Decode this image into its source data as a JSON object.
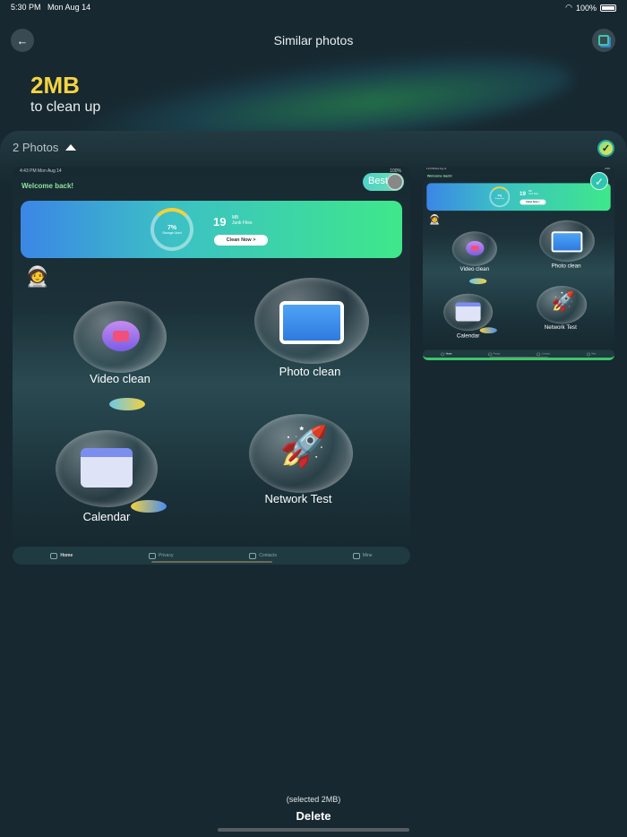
{
  "status_bar": {
    "time": "5:30 PM",
    "date": "Mon Aug 14",
    "battery": "100%"
  },
  "header": {
    "title": "Similar photos",
    "back_icon": "arrow-left-icon",
    "action_icon": "select-all-icon"
  },
  "summary": {
    "size": "2MB",
    "caption": "to clean up"
  },
  "group": {
    "label": "2 Photos",
    "all_selected": true
  },
  "photo": {
    "status": "4:43 PM   Mon Aug 14",
    "status_right": "100%",
    "welcome": "Welcome back!",
    "best_badge": "Best",
    "storage_pct": "7%",
    "storage_label": "Storage Used",
    "storage_progress": 0.07,
    "junk_count": "19",
    "junk_unit": "MB",
    "junk_label": "Junk Files",
    "clean_button": "Clean Now  >",
    "features": [
      "Video clean",
      "Photo clean",
      "Calendar",
      "Network Test"
    ],
    "tabs": [
      "Home",
      "Privacy",
      "Contacts",
      "Mine"
    ]
  },
  "footer": {
    "selected": "(selected 2MB)",
    "delete": "Delete"
  },
  "colors": {
    "accent": "#f5d342",
    "bg": "#172830",
    "selected": "#3ec46a"
  }
}
